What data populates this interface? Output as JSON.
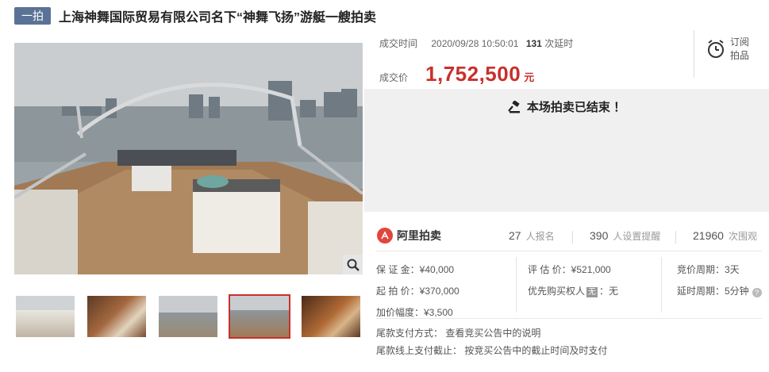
{
  "title": {
    "badge": "一拍",
    "text": "上海神舞国际贸易有限公司名下“神舞飞扬”游艇一艘拍卖"
  },
  "deal": {
    "time_label": "成交时间",
    "time_value": "2020/09/28 10:50:01",
    "delay_count": "131",
    "delay_label": "次延时",
    "price_label": "成交价",
    "price_value": "1,752,500",
    "price_unit": "元"
  },
  "subscribe": {
    "line1": "订阅",
    "line2": "拍品"
  },
  "ended": {
    "message": "本场拍卖已结束 ！"
  },
  "platform": {
    "name": "阿里拍卖"
  },
  "stats": [
    {
      "num": "27",
      "label": "人报名"
    },
    {
      "num": "390",
      "label": "人设置提醒"
    },
    {
      "num": "21960",
      "label": "次围观"
    }
  ],
  "details": {
    "deposit": "保 证 金：¥40,000",
    "start_price": "起 拍 价：¥370,000",
    "increment": "加价幅度：¥3,500",
    "appraisal": "评 估 价：¥521,000",
    "priority_label": "优先购买权人",
    "priority_tag": "无",
    "priority_value": "：无",
    "bid_period": "竞价周期：3天",
    "delay_period": "延时周期：5分钟",
    "final_payment_method": "尾款支付方式：  查看竞买公告中的说明",
    "final_payment_deadline": "尾款线上支付截止：  按竞买公告中的截止时间及时支付"
  },
  "colors": {
    "accent_red": "#c9302c",
    "badge_blue": "#5a7295",
    "banner_gray": "#f0f0f0"
  },
  "icons": [
    "zoom-icon",
    "alarm-clock-icon",
    "gavel-icon",
    "ali-auction-logo",
    "question-icon"
  ]
}
